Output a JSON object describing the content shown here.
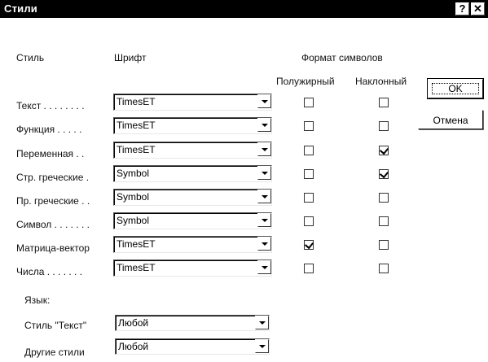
{
  "window": {
    "title": "Стили",
    "help_label": "?",
    "close_label": "✕"
  },
  "headers": {
    "style": "Стиль",
    "font": "Шрифт",
    "char_format": "Формат символов",
    "bold": "Полужирный",
    "italic": "Наклонный"
  },
  "rows": [
    {
      "label": "Текст . . . . . . . .",
      "font": "TimesET",
      "bold": false,
      "italic": false
    },
    {
      "label": "Функция . . . . .",
      "font": "TimesET",
      "bold": false,
      "italic": false
    },
    {
      "label": "Переменная . .",
      "font": "TimesET",
      "bold": false,
      "italic": true
    },
    {
      "label": "Стр. греческие .",
      "font": "Symbol",
      "bold": false,
      "italic": true
    },
    {
      "label": "Пр. греческие . .",
      "font": "Symbol",
      "bold": false,
      "italic": false
    },
    {
      "label": "Символ . . . . . . .",
      "font": "Symbol",
      "bold": false,
      "italic": false
    },
    {
      "label": "Матрица-вектор",
      "font": "TimesET",
      "bold": true,
      "italic": false
    },
    {
      "label": "Числа . . . . . . .",
      "font": "TimesET",
      "bold": false,
      "italic": false
    }
  ],
  "language": {
    "heading": "Язык:",
    "text_style_label": "Стиль \"Текст\"",
    "text_style_value": "Любой",
    "other_styles_label": "Другие стили",
    "other_styles_value": "Любой"
  },
  "buttons": {
    "ok": "OK",
    "cancel": "Отмена"
  }
}
